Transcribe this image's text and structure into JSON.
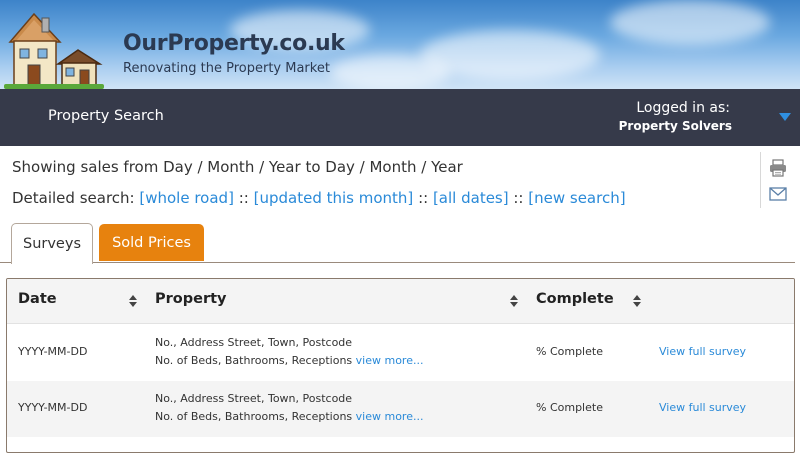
{
  "brand": {
    "title": "OurProperty.co.uk",
    "subtitle": "Renovating the Property Market"
  },
  "nav": {
    "property_search": "Property Search",
    "logged_in_label": "Logged in as:",
    "user_name": "Property Solvers"
  },
  "info": {
    "showing": "Showing sales from Day / Month / Year to Day / Month / Year",
    "detailed_label": "Detailed search:",
    "links": [
      "[whole road]",
      "[updated this month]",
      "[all dates]",
      "[new search]"
    ],
    "separator": "::"
  },
  "tabs": [
    {
      "label": "Surveys",
      "active": true
    },
    {
      "label": "Sold Prices",
      "active": false
    }
  ],
  "table": {
    "columns": [
      "Date",
      "Property",
      "Complete"
    ],
    "rows": [
      {
        "date": "YYYY-MM-DD",
        "address": "No., Address Street, Town, Postcode",
        "details": "No. of Beds, Bathrooms, Receptions",
        "view_more": "view more...",
        "complete": "% Complete",
        "action": "View full survey"
      },
      {
        "date": "YYYY-MM-DD",
        "address": "No., Address Street, Town, Postcode",
        "details": "No. of Beds, Bathrooms, Receptions",
        "view_more": "view more...",
        "complete": "% Complete",
        "action": "View full survey"
      }
    ]
  },
  "icons": [
    "houses-logo-icon",
    "printer-icon",
    "mail-icon",
    "chevron-down-icon",
    "sort-icon"
  ],
  "colors": {
    "navbar": "#363a4a",
    "link": "#2a8ad8",
    "tab_orange": "#e7820e",
    "brand_text": "#2b3a52"
  }
}
